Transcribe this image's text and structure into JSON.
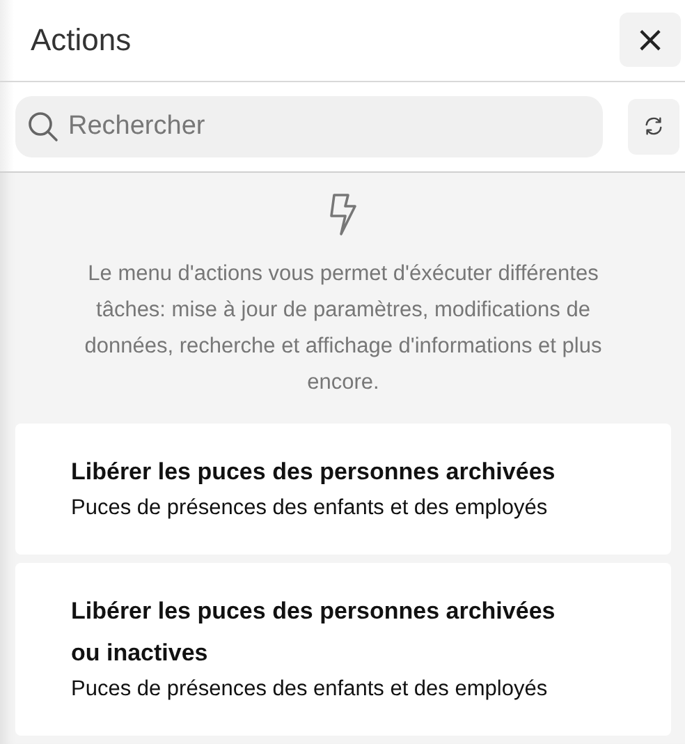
{
  "header": {
    "title": "Actions",
    "close_label": "×"
  },
  "search": {
    "placeholder": "Rechercher"
  },
  "intro": {
    "text": "Le menu d'actions vous permet d'éxécuter différentes tâches: mise à jour de paramètres, modifications de données, recherche et affichage d'informations et plus encore."
  },
  "actions": [
    {
      "title": "Libérer les puces des personnes archivées",
      "subtitle": "Puces de présences des enfants et des employés"
    },
    {
      "title": "Libérer les puces des personnes archivées ou inactives",
      "subtitle": "Puces de présences des enfants et des employés"
    }
  ]
}
